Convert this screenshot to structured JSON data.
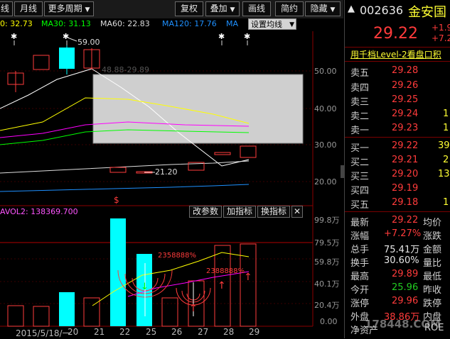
{
  "toolbar": {
    "left_partial": "线",
    "month": "月线",
    "more_periods": "更多周期",
    "fq": "复权",
    "overlay": "叠加",
    "draw": "画线",
    "simple": "简约",
    "hide": "隐藏"
  },
  "legend": {
    "ma20": "0: 32.73",
    "ma30": "MA30: 31.13",
    "ma60": "MA60: 22.83",
    "ma120": "MA120: 17.76",
    "ma_partial": "MA",
    "set_ma": "设置均线"
  },
  "main_annotations": {
    "high_label": "59.00",
    "range_label": "48.88-29.89",
    "low_label": "21.20"
  },
  "price_ticks": [
    "50.00",
    "40.00",
    "30.00",
    "20.00"
  ],
  "volume": {
    "label": "AVOL2: 138369.700",
    "buttons": [
      "改参数",
      "加指标",
      "换指标"
    ],
    "close_icon": "✕",
    "ticks": [
      "99.8万",
      "79.5万",
      "59.8万",
      "40.1万",
      "20.4万",
      "0.00"
    ],
    "annotations": [
      "2358888%",
      "2388888%"
    ]
  },
  "dates": [
    "2015/5/18/一",
    "20",
    "21",
    "22",
    "25",
    "26",
    "27",
    "28",
    "29"
  ],
  "colors": {
    "up": "#ff3b3b",
    "down": "#00ffff",
    "ma_white": "#ffffff",
    "ma_yellow": "#ffff00",
    "ma_magenta": "#ff00ff",
    "ma_green": "#00ff00",
    "ma_blue": "#1e90ff"
  },
  "quote": {
    "code": "002636",
    "name": "金安国",
    "price": "29.22",
    "change_partial": "+1.9",
    "pct_partial": "+7.2",
    "level2": "用千档Level-2看盘口积",
    "asks": [
      {
        "label": "卖五",
        "price": "29.28",
        "vol": ""
      },
      {
        "label": "卖四",
        "price": "29.26",
        "vol": ""
      },
      {
        "label": "卖三",
        "price": "29.25",
        "vol": ""
      },
      {
        "label": "卖二",
        "price": "29.24",
        "vol": "1"
      },
      {
        "label": "卖一",
        "price": "29.23",
        "vol": "1"
      }
    ],
    "bids": [
      {
        "label": "买一",
        "price": "29.22",
        "vol": "39"
      },
      {
        "label": "买二",
        "price": "29.21",
        "vol": "2"
      },
      {
        "label": "买三",
        "price": "29.20",
        "vol": "13"
      },
      {
        "label": "买四",
        "price": "29.19",
        "vol": ""
      },
      {
        "label": "买五",
        "price": "29.18",
        "vol": "1"
      }
    ],
    "stats": [
      {
        "l1": "最新",
        "v1": "29.22",
        "l2": "均价"
      },
      {
        "l1": "涨幅",
        "v1": "+7.27%",
        "l2": "涨跌"
      },
      {
        "l1": "总手",
        "v1": "75.41万",
        "l2": "金额"
      },
      {
        "l1": "换手",
        "v1": "30.60%",
        "l2": "量比"
      },
      {
        "l1": "最高",
        "v1": "29.89",
        "l2": "最低"
      },
      {
        "l1": "今开",
        "v1": "25.96",
        "l2": "昨收"
      },
      {
        "l1": "涨停",
        "v1": "29.96",
        "l2": "跌停"
      },
      {
        "l1": "外盘",
        "v1": "38.86万",
        "l2": "内盘"
      },
      {
        "l1": "净资产",
        "v1": "",
        "l2": "ROE"
      }
    ],
    "watermark": "178448.COM"
  }
}
